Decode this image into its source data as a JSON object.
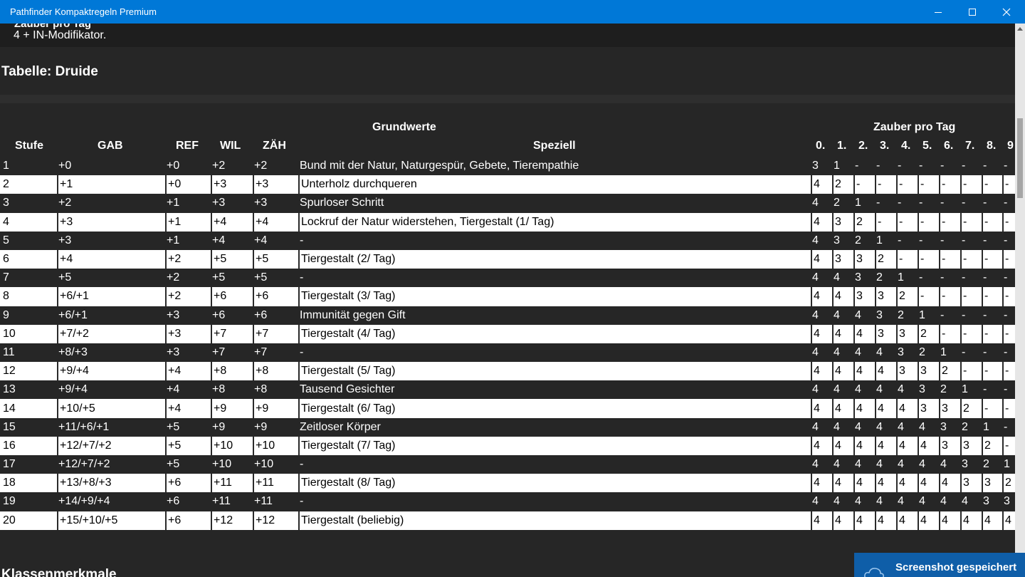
{
  "window": {
    "title": "Pathfinder Kompaktregeln Premium"
  },
  "content": {
    "cut_text": "Zauber pro Tag",
    "modifier_line": "4 + IN-Modifikator.",
    "table_heading": "Tabelle: Druide",
    "group_headers": {
      "base": "Grundwerte",
      "spells": "Zauber pro Tag"
    },
    "columns": {
      "level": "Stufe",
      "bab": "GAB",
      "ref": "REF",
      "wil": "WIL",
      "fort": "ZÄH",
      "special": "Speziell",
      "spell_levels": [
        "0.",
        "1.",
        "2.",
        "3.",
        "4.",
        "5.",
        "6.",
        "7.",
        "8.",
        "9"
      ]
    },
    "rows": [
      {
        "level": "1",
        "bab": "+0",
        "ref": "+0",
        "wil": "+2",
        "fort": "+2",
        "special": "Bund mit der Natur, Naturgespür, Gebete, Tierempathie",
        "spells": [
          "3",
          "1",
          "-",
          "-",
          "-",
          "-",
          "-",
          "-",
          "-",
          "-"
        ]
      },
      {
        "level": "2",
        "bab": "+1",
        "ref": "+0",
        "wil": "+3",
        "fort": "+3",
        "special": "Unterholz durchqueren",
        "spells": [
          "4",
          "2",
          "-",
          "-",
          "-",
          "-",
          "-",
          "-",
          "-",
          "-"
        ]
      },
      {
        "level": "3",
        "bab": "+2",
        "ref": "+1",
        "wil": "+3",
        "fort": "+3",
        "special": "Spurloser Schritt",
        "spells": [
          "4",
          "2",
          "1",
          "-",
          "-",
          "-",
          "-",
          "-",
          "-",
          "-"
        ]
      },
      {
        "level": "4",
        "bab": "+3",
        "ref": "+1",
        "wil": "+4",
        "fort": "+4",
        "special": "Lockruf der Natur widerstehen, Tiergestalt (1/ Tag)",
        "spells": [
          "4",
          "3",
          "2",
          "-",
          "-",
          "-",
          "-",
          "-",
          "-",
          "-"
        ]
      },
      {
        "level": "5",
        "bab": "+3",
        "ref": "+1",
        "wil": "+4",
        "fort": "+4",
        "special": "-",
        "spells": [
          "4",
          "3",
          "2",
          "1",
          "-",
          "-",
          "-",
          "-",
          "-",
          "-"
        ]
      },
      {
        "level": "6",
        "bab": "+4",
        "ref": "+2",
        "wil": "+5",
        "fort": "+5",
        "special": "Tiergestalt (2/ Tag)",
        "spells": [
          "4",
          "3",
          "3",
          "2",
          "-",
          "-",
          "-",
          "-",
          "-",
          "-"
        ]
      },
      {
        "level": "7",
        "bab": "+5",
        "ref": "+2",
        "wil": "+5",
        "fort": "+5",
        "special": "-",
        "spells": [
          "4",
          "4",
          "3",
          "2",
          "1",
          "-",
          "-",
          "-",
          "-",
          "-"
        ]
      },
      {
        "level": "8",
        "bab": "+6/+1",
        "ref": "+2",
        "wil": "+6",
        "fort": "+6",
        "special": "Tiergestalt (3/ Tag)",
        "spells": [
          "4",
          "4",
          "3",
          "3",
          "2",
          "-",
          "-",
          "-",
          "-",
          "-"
        ]
      },
      {
        "level": "9",
        "bab": "+6/+1",
        "ref": "+3",
        "wil": "+6",
        "fort": "+6",
        "special": "Immunität gegen Gift",
        "spells": [
          "4",
          "4",
          "4",
          "3",
          "2",
          "1",
          "-",
          "-",
          "-",
          "-"
        ]
      },
      {
        "level": "10",
        "bab": "+7/+2",
        "ref": "+3",
        "wil": "+7",
        "fort": "+7",
        "special": "Tiergestalt (4/ Tag)",
        "spells": [
          "4",
          "4",
          "4",
          "3",
          "3",
          "2",
          "-",
          "-",
          "-",
          "-"
        ]
      },
      {
        "level": "11",
        "bab": "+8/+3",
        "ref": "+3",
        "wil": "+7",
        "fort": "+7",
        "special": "-",
        "spells": [
          "4",
          "4",
          "4",
          "4",
          "3",
          "2",
          "1",
          "-",
          "-",
          "-"
        ]
      },
      {
        "level": "12",
        "bab": "+9/+4",
        "ref": "+4",
        "wil": "+8",
        "fort": "+8",
        "special": "Tiergestalt (5/ Tag)",
        "spells": [
          "4",
          "4",
          "4",
          "4",
          "3",
          "3",
          "2",
          "-",
          "-",
          "-"
        ]
      },
      {
        "level": "13",
        "bab": "+9/+4",
        "ref": "+4",
        "wil": "+8",
        "fort": "+8",
        "special": "Tausend Gesichter",
        "spells": [
          "4",
          "4",
          "4",
          "4",
          "4",
          "3",
          "2",
          "1",
          "-",
          "-"
        ]
      },
      {
        "level": "14",
        "bab": "+10/+5",
        "ref": "+4",
        "wil": "+9",
        "fort": "+9",
        "special": "Tiergestalt (6/ Tag)",
        "spells": [
          "4",
          "4",
          "4",
          "4",
          "4",
          "3",
          "3",
          "2",
          "-",
          "-"
        ]
      },
      {
        "level": "15",
        "bab": "+11/+6/+1",
        "ref": "+5",
        "wil": "+9",
        "fort": "+9",
        "special": "Zeitloser Körper",
        "spells": [
          "4",
          "4",
          "4",
          "4",
          "4",
          "4",
          "3",
          "2",
          "1",
          "-"
        ]
      },
      {
        "level": "16",
        "bab": "+12/+7/+2",
        "ref": "+5",
        "wil": "+10",
        "fort": "+10",
        "special": "Tiergestalt (7/ Tag)",
        "spells": [
          "4",
          "4",
          "4",
          "4",
          "4",
          "4",
          "3",
          "3",
          "2",
          "-"
        ]
      },
      {
        "level": "17",
        "bab": "+12/+7/+2",
        "ref": "+5",
        "wil": "+10",
        "fort": "+10",
        "special": "-",
        "spells": [
          "4",
          "4",
          "4",
          "4",
          "4",
          "4",
          "4",
          "3",
          "2",
          "1"
        ]
      },
      {
        "level": "18",
        "bab": "+13/+8/+3",
        "ref": "+6",
        "wil": "+11",
        "fort": "+11",
        "special": "Tiergestalt (8/ Tag)",
        "spells": [
          "4",
          "4",
          "4",
          "4",
          "4",
          "4",
          "4",
          "3",
          "3",
          "2"
        ]
      },
      {
        "level": "19",
        "bab": "+14/+9/+4",
        "ref": "+6",
        "wil": "+11",
        "fort": "+11",
        "special": "-",
        "spells": [
          "4",
          "4",
          "4",
          "4",
          "4",
          "4",
          "4",
          "4",
          "3",
          "3"
        ]
      },
      {
        "level": "20",
        "bab": "+15/+10/+5",
        "ref": "+6",
        "wil": "+12",
        "fort": "+12",
        "special": "Tiergestalt (beliebig)",
        "spells": [
          "4",
          "4",
          "4",
          "4",
          "4",
          "4",
          "4",
          "4",
          "4",
          "4"
        ]
      }
    ],
    "bottom_heading": "Klassenmerkmale"
  },
  "toast": {
    "text": "Screenshot gespeichert"
  },
  "colors": {
    "titlebar": "#0078d7",
    "background": "#262626",
    "row_light": "#ffffff",
    "toast": "#0f5ea8"
  }
}
